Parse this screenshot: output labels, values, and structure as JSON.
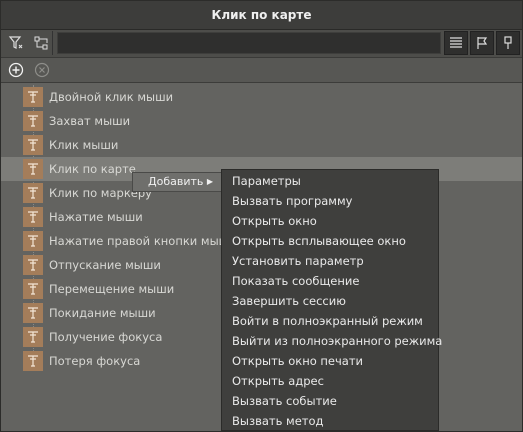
{
  "window": {
    "title": "Клик по карте"
  },
  "toolbar": {
    "left_icons": [
      "filter-icon",
      "flow-icon"
    ],
    "search_value": "",
    "right_icons": [
      "list-view-icon",
      "flag-icon",
      "pin-icon"
    ]
  },
  "actions": {
    "icons": [
      "add-circle-icon",
      "remove-circle-icon"
    ]
  },
  "events": [
    {
      "label": "Двойной клик мыши",
      "selected": false
    },
    {
      "label": "Захват мыши",
      "selected": false
    },
    {
      "label": "Клик мыши",
      "selected": false
    },
    {
      "label": "Клик по карте",
      "selected": true
    },
    {
      "label": "Клик по маркеру",
      "selected": false
    },
    {
      "label": "Нажатие мыши",
      "selected": false
    },
    {
      "label": "Нажатие правой кнопки мыши",
      "selected": false
    },
    {
      "label": "Отпускание мыши",
      "selected": false
    },
    {
      "label": "Перемещение мыши",
      "selected": false
    },
    {
      "label": "Покидание мыши",
      "selected": false
    },
    {
      "label": "Получение фокуса",
      "selected": false
    },
    {
      "label": "Потеря фокуса",
      "selected": false
    }
  ],
  "context": {
    "add_label": "Добавить",
    "items": [
      "Параметры",
      "Вызвать программу",
      "Открыть окно",
      "Открыть всплывающее окно",
      "Установить параметр",
      "Показать сообщение",
      "Завершить сессию",
      "Войти в полноэкранный режим",
      "Выйти из полноэкранного режима",
      "Открыть окно печати",
      "Открыть адрес",
      "Вызвать событие",
      "Вызвать метод"
    ]
  },
  "colors": {
    "panel": "#636360",
    "selected_row": "#7d7d79",
    "event_icon": "#a47d5a",
    "menu_bg": "#3f3f3d"
  }
}
